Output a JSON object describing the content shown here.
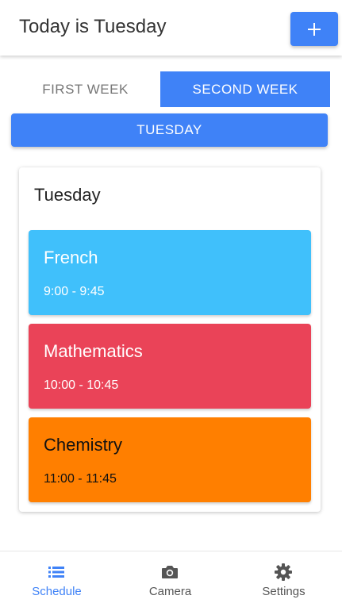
{
  "header": {
    "title": "Today is Tuesday",
    "add_icon": "plus-icon"
  },
  "tabs": [
    {
      "label": "FIRST WEEK",
      "active": false
    },
    {
      "label": "SECOND WEEK",
      "active": true
    }
  ],
  "day_selector": {
    "label": "TUESDAY"
  },
  "schedule": {
    "day_title": "Tuesday",
    "lessons": [
      {
        "name": "French",
        "time": "9:00 - 9:45",
        "color": "#40c0fb",
        "text_color": "#ffffff"
      },
      {
        "name": "Mathematics",
        "time": "10:00 - 10:45",
        "color": "#ea4358",
        "text_color": "#ffffff"
      },
      {
        "name": "Chemistry",
        "time": "11:00 - 11:45",
        "color": "#ff7f00",
        "text_color": "#111111"
      }
    ]
  },
  "bottom_nav": [
    {
      "label": "Schedule",
      "icon": "list-icon",
      "active": true
    },
    {
      "label": "Camera",
      "icon": "camera-icon",
      "active": false
    },
    {
      "label": "Settings",
      "icon": "gear-icon",
      "active": false
    }
  ],
  "colors": {
    "accent": "#3f82f7",
    "inactive_nav": "#555555"
  }
}
